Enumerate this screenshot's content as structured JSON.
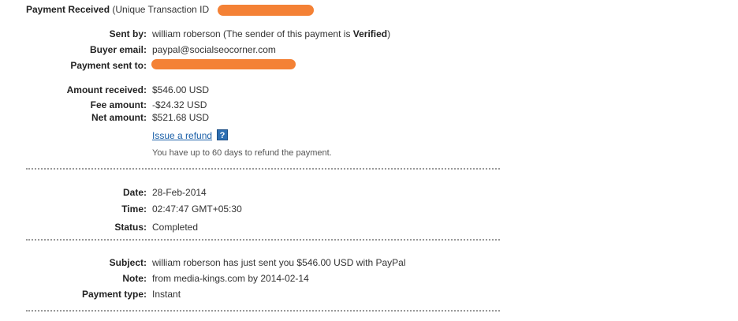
{
  "header": {
    "title_bold": "Payment Received",
    "title_rest": " (Unique Transaction ID"
  },
  "payer": {
    "sent_by_label": "Sent by:",
    "sent_by_value": "william roberson (The sender of this payment is ",
    "sent_by_status": "Verified",
    "sent_by_close": ")",
    "buyer_email_label": "Buyer email:",
    "buyer_email_value": "paypal@socialseocorner.com",
    "payment_sent_to_label": "Payment sent to:"
  },
  "amounts": {
    "received_label": "Amount received:",
    "received_value": "$546.00 USD",
    "fee_label": "Fee amount:",
    "fee_value": "-$24.32 USD",
    "net_label": "Net amount:",
    "net_value": "$521.68 USD"
  },
  "refund": {
    "link_label": "Issue a refund",
    "help_icon": "?",
    "note": "You have up to 60 days to refund the payment."
  },
  "details": {
    "date_label": "Date:",
    "date_value": "28-Feb-2014",
    "time_label": "Time:",
    "time_value": "02:47:47 GMT+05:30",
    "status_label": "Status:",
    "status_value": "Completed"
  },
  "message": {
    "subject_label": "Subject:",
    "subject_value": "william roberson has just sent you $546.00 USD with PayPal",
    "note_label": "Note:",
    "note_value": "from media-kings.com by 2014-02-14",
    "payment_type_label": "Payment type:",
    "payment_type_value": "Instant"
  },
  "colors": {
    "redaction": "#f37a2a",
    "link": "#1a5fa8",
    "help_icon_bg": "#2d6fb3"
  },
  "icons": {
    "help": "help-icon"
  }
}
